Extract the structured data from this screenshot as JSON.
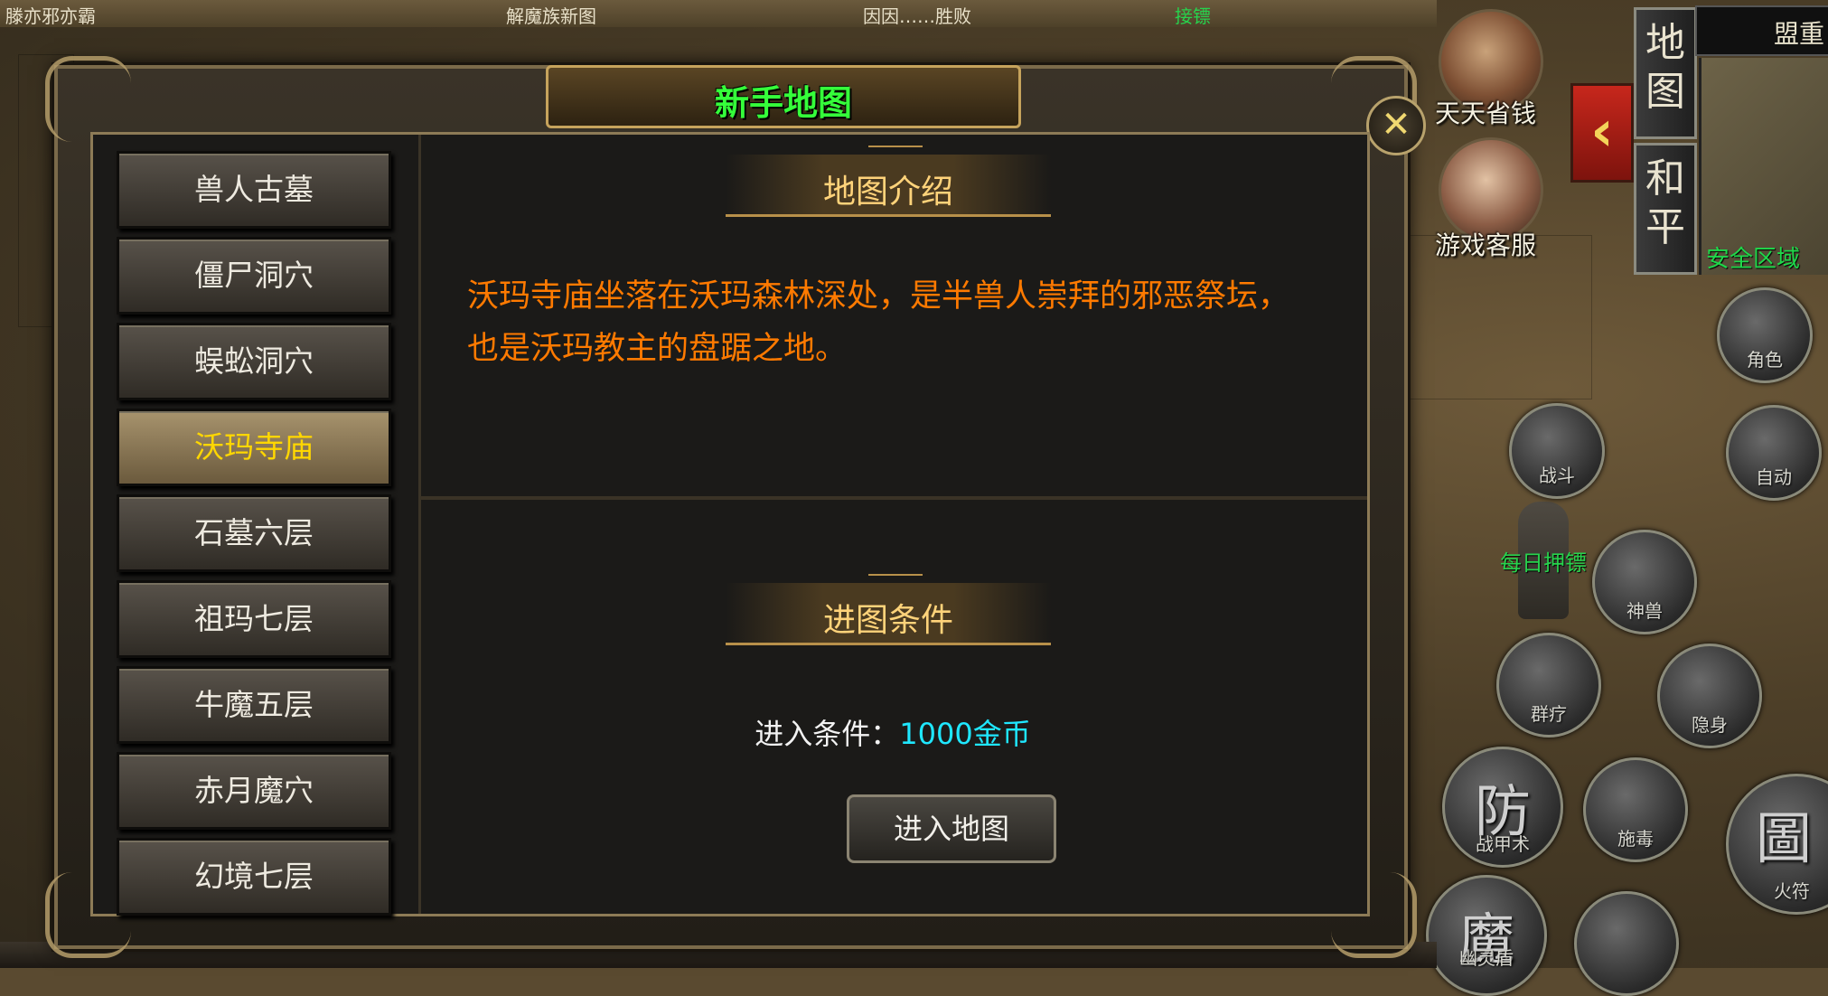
{
  "top_strip": [
    "滕亦邪亦霸",
    "解魔族新图",
    "因因……胜败",
    "接镖"
  ],
  "dialog": {
    "title": "新手地图",
    "close_icon": "close-x-icon",
    "maps": [
      "兽人古墓",
      "僵尸洞穴",
      "蜈蚣洞穴",
      "沃玛寺庙",
      "石墓六层",
      "祖玛七层",
      "牛魔五层",
      "赤月魔穴",
      "幻境七层"
    ],
    "selected_map_index": 3,
    "intro_header": "地图介绍",
    "intro_text": "沃玛寺庙坐落在沃玛森林深处，是半兽人崇拜的邪恶祭坛，也是沃玛教主的盘踞之地。",
    "cond_header": "进图条件",
    "cond_key": "进入条件：",
    "cond_value": "1000金币",
    "enter_button": "进入地图"
  },
  "hud": {
    "portrait_top_label": "天天省钱",
    "portrait_service_label": "游戏客服",
    "tab_map": "地图",
    "tab_peace": "和平",
    "minimap_title": "盟重",
    "safe_zone": "安全区域",
    "npc_label": "每日押镖",
    "collapse_icon": "chevron-left-icon",
    "skills": {
      "role": "角色",
      "fight": "战斗",
      "auto": "自动",
      "beast": "神兽",
      "heal": "群疗",
      "stealth": "隐身",
      "armor_glyph": "防",
      "armor": "战甲术",
      "poison": "施毒",
      "fire_glyph": "圖",
      "fire": "火符",
      "shield_glyph": "魔",
      "shield": "幽灵盾"
    }
  },
  "colors": {
    "title_green": "#35ff3a",
    "desc_orange": "#ff7a00",
    "cond_cyan": "#1fe7ff",
    "active_gold": "#ffd700"
  }
}
